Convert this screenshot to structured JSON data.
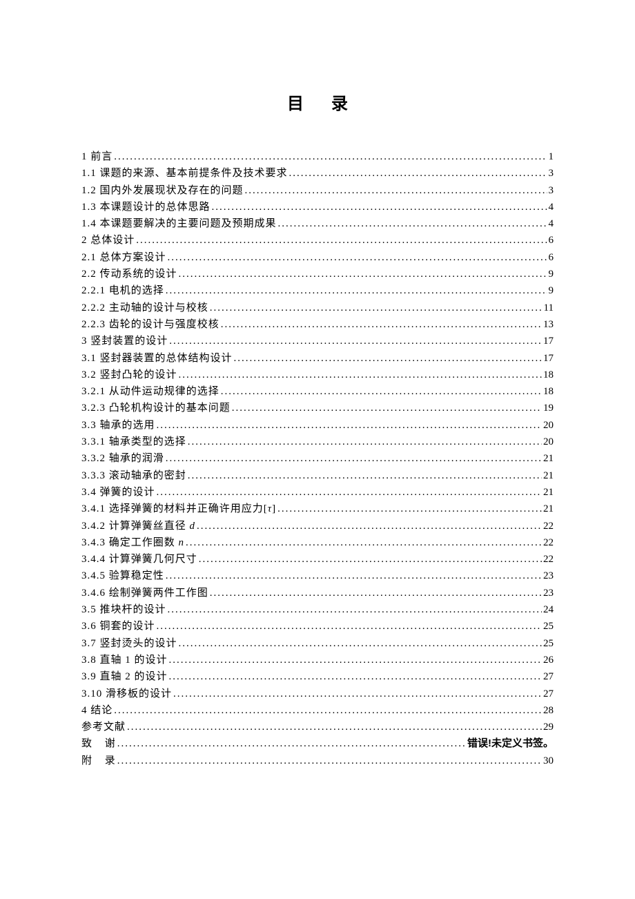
{
  "title": "目录",
  "entries": [
    {
      "label": "1 前言",
      "page": "1"
    },
    {
      "label": "1.1 课题的来源、基本前提条件及技术要求",
      "page": "3"
    },
    {
      "label": "1.2 国内外发展现状及存在的问题",
      "page": "3"
    },
    {
      "label": "1.3 本课题设计的总体思路",
      "page": "4"
    },
    {
      "label": "1.4 本课题要解决的主要问题及预期成果",
      "page": "4"
    },
    {
      "label": "2 总体设计",
      "page": "6"
    },
    {
      "label": "2.1 总体方案设计",
      "page": "6"
    },
    {
      "label": "2.2 传动系统的设计",
      "page": "9"
    },
    {
      "label": "2.2.1 电机的选择",
      "page": "9"
    },
    {
      "label": "2.2.2 主动轴的设计与校核",
      "page": "11"
    },
    {
      "label": "2.2.3 齿轮的设计与强度校核",
      "page": "13"
    },
    {
      "label": "3 竖封装置的设计",
      "page": "17"
    },
    {
      "label": "3.1 竖封器装置的总体结构设计",
      "page": "17"
    },
    {
      "label": "3.2 竖封凸轮的设计",
      "page": "18"
    },
    {
      "label": "3.2.1 从动件运动规律的选择",
      "page": "18"
    },
    {
      "label": "3.2.3 凸轮机构设计的基本问题",
      "page": "19"
    },
    {
      "label": "3.3 轴承的选用",
      "page": "20"
    },
    {
      "label": "3.3.1 轴承类型的选择",
      "page": "20"
    },
    {
      "label": "3.3.2 轴承的润滑",
      "page": "21"
    },
    {
      "label": "3.3.3 滚动轴承的密封",
      "page": "21"
    },
    {
      "label": "3.4 弹簧的设计",
      "page": "21"
    },
    {
      "label": "3.4.1 选择弹簧的材料并正确许用应力[τ]",
      "page": "21",
      "special": "tau"
    },
    {
      "label": "3.4.2 计算弹簧丝直径 d",
      "page": "22",
      "special": "d"
    },
    {
      "label": "3.4.3 确定工作圈数 n",
      "page": "22",
      "special": "n"
    },
    {
      "label": "3.4.4 计算弹簧几何尺寸",
      "page": "22"
    },
    {
      "label": "3.4.5 验算稳定性",
      "page": "23"
    },
    {
      "label": "3.4.6 绘制弹簧两件工作图",
      "page": "23"
    },
    {
      "label": "3.5 推块杆的设计",
      "page": "24"
    },
    {
      "label": "3.6 铜套的设计",
      "page": "25"
    },
    {
      "label": "3.7 竖封烫头的设计",
      "page": "25"
    },
    {
      "label": "3.8 直轴 1 的设计",
      "page": "26"
    },
    {
      "label": "3.9 直轴 2 的设计",
      "page": "27"
    },
    {
      "label": "3.10 滑移板的设计",
      "page": "27"
    },
    {
      "label": "4 结论",
      "page": "28"
    },
    {
      "label": "参考文献",
      "page": "29"
    },
    {
      "label": "致  谢",
      "page": "错误!未定义书签。",
      "error": true,
      "spaced": true
    },
    {
      "label": "附  录",
      "page": "30",
      "spaced": true
    }
  ]
}
